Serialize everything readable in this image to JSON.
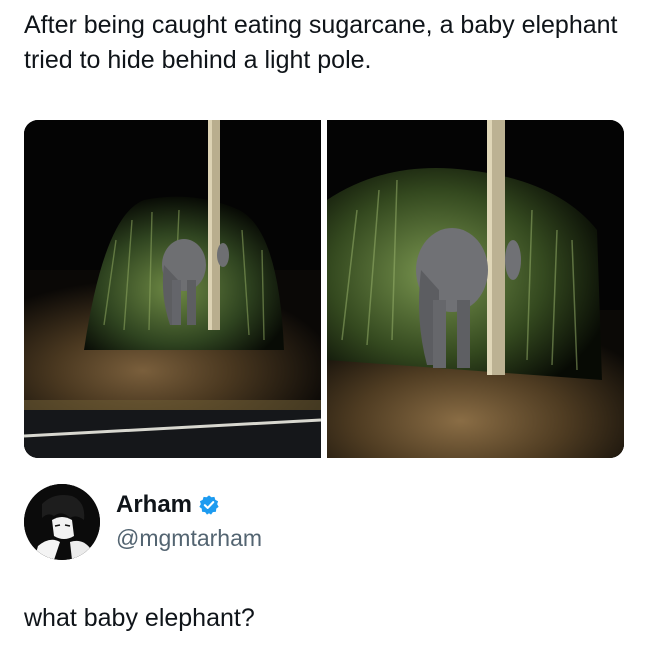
{
  "post": {
    "headline": "After being caught eating sugarcane, a baby elephant tried to hide behind a light pole."
  },
  "media": {
    "images": [
      {
        "description_icon": "elephant-pole-photo"
      },
      {
        "description_icon": "elephant-pole-photo"
      }
    ]
  },
  "author": {
    "name": "Arham",
    "handle": "@mgmtarham",
    "verified": true,
    "avatar_icon": "anime-portrait"
  },
  "reply": {
    "text": "what baby elephant?"
  },
  "colors": {
    "text": "#0f1419",
    "handle": "#536471",
    "verified_badge": "#1d9bf0",
    "background": "#ffffff"
  }
}
